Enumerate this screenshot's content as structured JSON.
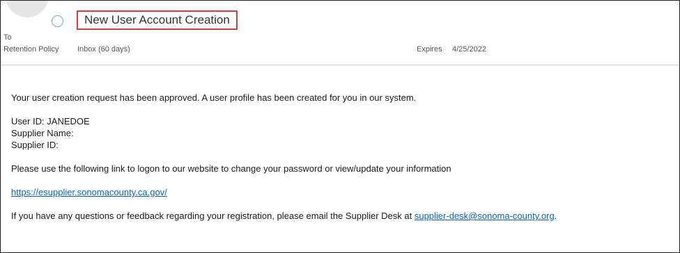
{
  "header": {
    "subject": "New User Account Creation",
    "to_label": "To",
    "retention_label": "Retention Policy",
    "retention_value": "Inbox (60 days)",
    "expires_label": "Expires",
    "expires_value": "4/25/2022",
    "accent_color": "#e03a3a"
  },
  "body": {
    "intro": "Your user creation request has been approved.  A user profile has been created for you in our system.",
    "user_id": "User ID:  JANEDOE",
    "supplier_name": "Supplier Name:",
    "supplier_id": "Supplier ID:",
    "link_instruction": "Please use the following link to logon to our website to change your password or view/update your information",
    "link_url": "https://esupplier.sonomacounty.ca.gov/",
    "contact_text": "If you have any questions or feedback regarding your registration, please email the Supplier Desk at ",
    "contact_email": "supplier-desk@sonoma-county.org",
    "contact_end": ".",
    "link_color": "#0563c1"
  }
}
